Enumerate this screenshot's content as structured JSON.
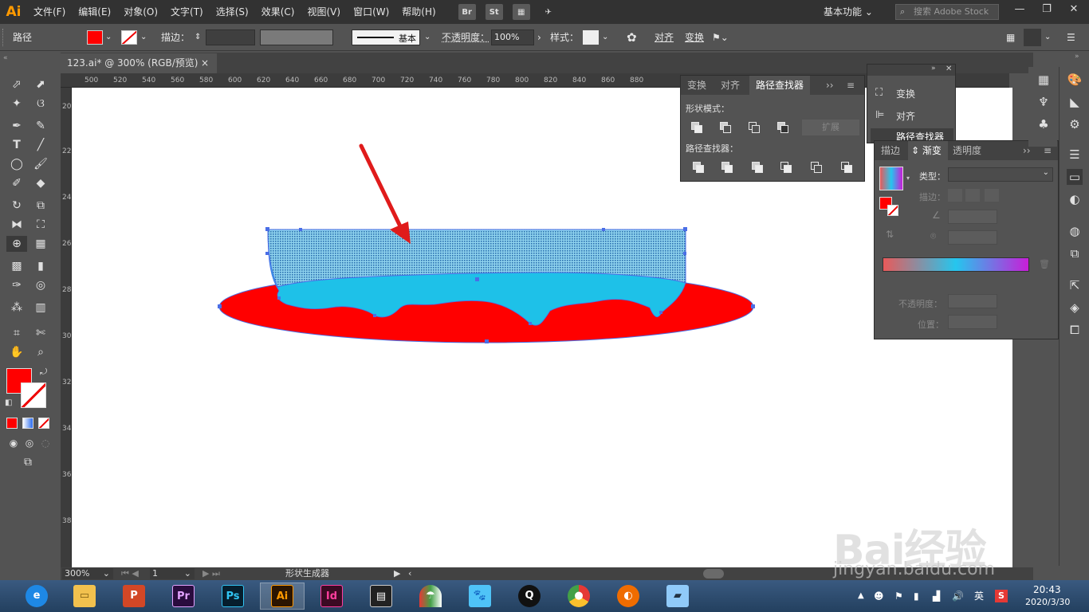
{
  "app": {
    "logo": "Ai",
    "menu": [
      "文件(F)",
      "编辑(E)",
      "对象(O)",
      "文字(T)",
      "选择(S)",
      "效果(C)",
      "视图(V)",
      "窗口(W)",
      "帮助(H)"
    ],
    "bridge_label": "Br",
    "stock_label": "St",
    "workspace": "基本功能",
    "search_placeholder": "搜索 Adobe Stock",
    "win_min": "—",
    "win_restore": "❐",
    "win_close": "✕"
  },
  "controlbar": {
    "selection_type": "路径",
    "stroke_label": "描边：",
    "brush_label": "基本",
    "opacity_label": "不透明度：",
    "opacity_value": "100%",
    "style_label": "样式：",
    "align_label": "对齐",
    "transform_label": "变换",
    "fill_color": "#ff0000"
  },
  "document": {
    "tab_title": "123.ai* @ 300% (RGB/预览)",
    "close": "×"
  },
  "ruler": {
    "top_ticks": [
      "500",
      "520",
      "540",
      "560",
      "580",
      "600",
      "620",
      "640",
      "660",
      "680",
      "700",
      "720",
      "740",
      "760",
      "780",
      "800",
      "820",
      "840",
      "860",
      "880"
    ],
    "left_ticks": [
      "200",
      "220",
      "240",
      "260",
      "280",
      "300",
      "320",
      "340",
      "360",
      "380"
    ]
  },
  "statusbar": {
    "zoom": "300%",
    "page": "1",
    "tool_name": "形状生成器"
  },
  "pathfinder_panel": {
    "tabs": [
      "变换",
      "对齐",
      "路径查找器"
    ],
    "shape_modes_label": "形状模式：",
    "expand_label": "扩展",
    "pathfinders_label": "路径查找器："
  },
  "mini_panel": {
    "items": [
      "变换",
      "对齐",
      "路径查找器"
    ]
  },
  "gradient_panel": {
    "tabs": [
      "描边",
      "渐变",
      "透明度"
    ],
    "type_label": "类型：",
    "stroke_label": "描边：",
    "opacity_label": "不透明度：",
    "position_label": "位置：",
    "gradient_start": "#e85a5a",
    "gradient_mid": "#25c6ee",
    "gradient_end": "#c81ed8"
  },
  "artwork": {
    "ellipse_color": "#ff0000",
    "water_color": "#1ec1e8",
    "selection_color": "#4a6ee6",
    "arrow_color": "#e01b1b"
  },
  "taskbar": {
    "apps": [
      "IE",
      "Explorer",
      "PowerPoint",
      "Premiere",
      "Photoshop",
      "Illustrator",
      "InDesign",
      "Video",
      "Umbrella",
      "Dog",
      "QQ",
      "Chrome",
      "Firefox",
      "Notepad"
    ],
    "ime": "英",
    "time": "20:43",
    "date": "2020/3/30"
  },
  "watermark": {
    "text": "Bai经验",
    "url": "jingyan.baidu.com"
  }
}
